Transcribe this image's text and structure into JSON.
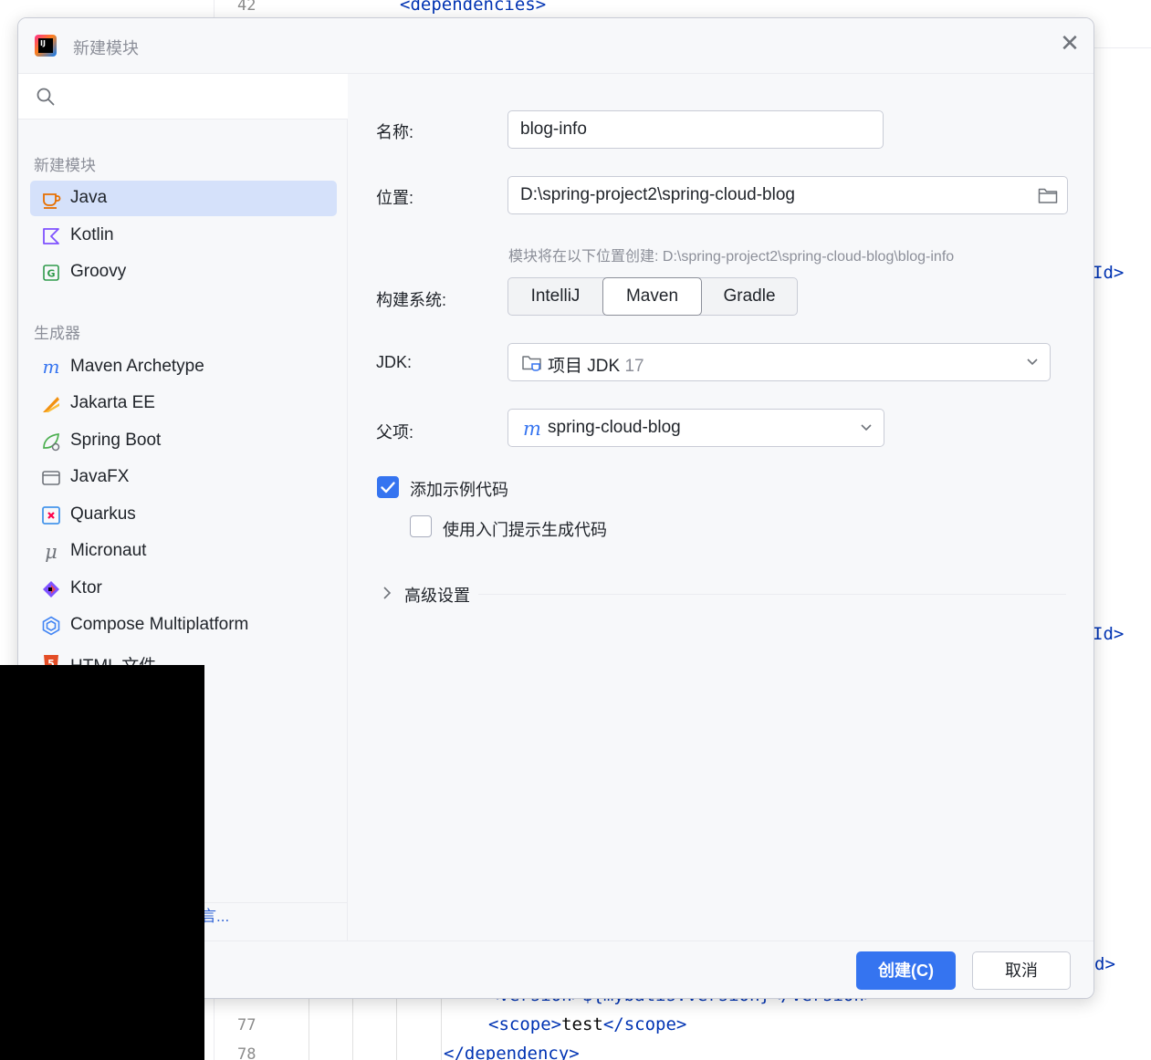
{
  "editor": {
    "line_42_number": "42",
    "line_42_code": "<dependencies>",
    "right_fragment_1": "Id>",
    "right_fragment_2": "Id>",
    "right_fragment_3": "d>",
    "line_76_code": "<version>${mybatis.version}</version>",
    "line_77_number": "77",
    "line_77_open": "<scope>",
    "line_77_value": "test",
    "line_77_close": "</scope>",
    "line_78_number": "78",
    "line_78_code": "</dependency>"
  },
  "dialog": {
    "title": "新建模块",
    "close_glyph": "✕"
  },
  "sidebar": {
    "group_new": "新建模块",
    "group_generators": "生成器",
    "items": [
      {
        "label": "Java",
        "icon": "java-icon",
        "selected": true
      },
      {
        "label": "Kotlin",
        "icon": "kotlin-icon"
      },
      {
        "label": "Groovy",
        "icon": "groovy-icon"
      },
      {
        "label": "Maven Archetype",
        "icon": "maven-icon"
      },
      {
        "label": "Jakarta EE",
        "icon": "jakarta-ee-icon"
      },
      {
        "label": "Spring Boot",
        "icon": "spring-boot-icon"
      },
      {
        "label": "JavaFX",
        "icon": "javafx-icon"
      },
      {
        "label": "Quarkus",
        "icon": "quarkus-icon"
      },
      {
        "label": "Micronaut",
        "icon": "micronaut-icon"
      },
      {
        "label": "Ktor",
        "icon": "ktor-icon"
      },
      {
        "label": "Compose Multiplatform",
        "icon": "compose-icon"
      },
      {
        "label": "HTML 文件",
        "icon": "html-icon"
      }
    ],
    "more_link": "言..."
  },
  "form": {
    "name_label": "名称:",
    "name_value": "blog-info",
    "location_label": "位置:",
    "location_value": "D:\\spring-project2\\spring-cloud-blog",
    "location_hint": "模块将在以下位置创建: D:\\spring-project2\\spring-cloud-blog\\blog-info",
    "build_label": "构建系统:",
    "build_options": [
      "IntelliJ",
      "Maven",
      "Gradle"
    ],
    "build_selected": "Maven",
    "jdk_label": "JDK:",
    "jdk_value": "项目 JDK",
    "jdk_version": "17",
    "parent_label": "父项:",
    "parent_value": "spring-cloud-blog",
    "sample_code_label": "添加示例代码",
    "sample_code_checked": true,
    "onboarding_label": "使用入门提示生成代码",
    "onboarding_checked": false,
    "advanced_label": "高级设置"
  },
  "footer": {
    "create_label": "创建(C)",
    "cancel_label": "取消"
  },
  "colors": {
    "accent": "#3574f0",
    "selection": "#d5e1fa",
    "muted_text": "#8c8f99"
  }
}
